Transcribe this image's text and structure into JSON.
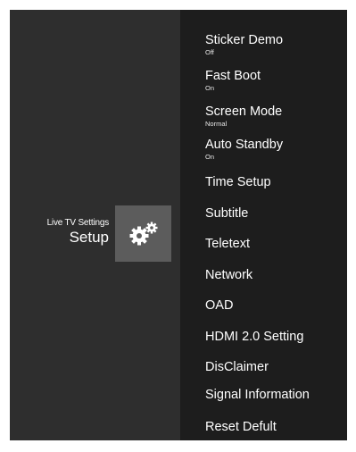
{
  "breadcrumb": {
    "parent": "Live TV Settings",
    "title": "Setup"
  },
  "icon": {
    "name": "gear-icon",
    "tile_color": "#5c5c5c"
  },
  "menu": {
    "items": [
      {
        "label": "Sticker Demo",
        "value": "Off"
      },
      {
        "label": "Fast Boot",
        "value": "On"
      },
      {
        "label": "Screen Mode",
        "value": "Normal"
      },
      {
        "label": "Auto Standby",
        "value": "On"
      },
      {
        "label": "Time Setup"
      },
      {
        "label": "Subtitle"
      },
      {
        "label": "Teletext"
      },
      {
        "label": "Network"
      },
      {
        "label": "OAD"
      },
      {
        "label": "HDMI 2.0 Setting"
      },
      {
        "label": "DisClaimer"
      },
      {
        "label": "Signal Information"
      },
      {
        "label": "Reset Defult"
      }
    ]
  },
  "colors": {
    "left_background": "#2e2e2e",
    "right_background": "#1d1d1d",
    "text": "#ffffff"
  }
}
